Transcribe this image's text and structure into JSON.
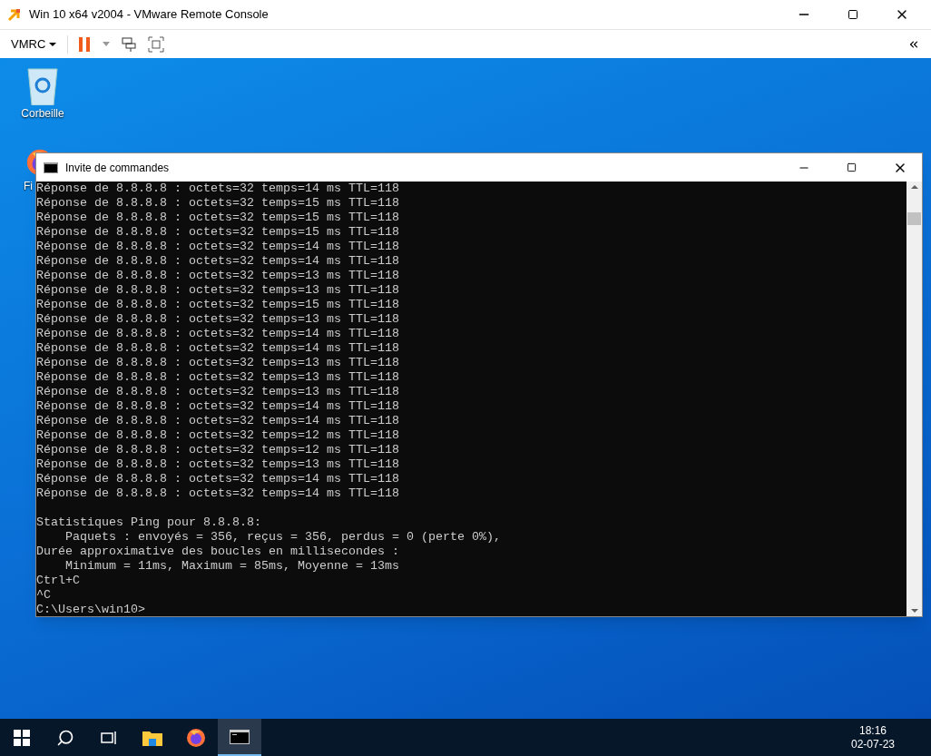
{
  "vmrc": {
    "title": "Win 10 x64 v2004 - VMware Remote Console",
    "menu": "VMRC"
  },
  "desktop_icons": [
    {
      "label": "Corbeille",
      "kind": "recycle"
    },
    {
      "label": "Fi",
      "kind": "firefox"
    }
  ],
  "cmd": {
    "title": "Invite de commandes",
    "blocks": [
      [
        "Réponse de 8.8.8.8 : octets=32 temps=14 ms TTL=118",
        "Réponse de 8.8.8.8 : octets=32 temps=15 ms TTL=118",
        "Réponse de 8.8.8.8 : octets=32 temps=15 ms TTL=118",
        "Réponse de 8.8.8.8 : octets=32 temps=15 ms TTL=118",
        "Réponse de 8.8.8.8 : octets=32 temps=14 ms TTL=118",
        "Réponse de 8.8.8.8 : octets=32 temps=14 ms TTL=118",
        "Réponse de 8.8.8.8 : octets=32 temps=13 ms TTL=118",
        "Réponse de 8.8.8.8 : octets=32 temps=13 ms TTL=118",
        "Réponse de 8.8.8.8 : octets=32 temps=15 ms TTL=118",
        "Réponse de 8.8.8.8 : octets=32 temps=13 ms TTL=118",
        "Réponse de 8.8.8.8 : octets=32 temps=14 ms TTL=118",
        "Réponse de 8.8.8.8 : octets=32 temps=14 ms TTL=118",
        "Réponse de 8.8.8.8 : octets=32 temps=13 ms TTL=118",
        "Réponse de 8.8.8.8 : octets=32 temps=13 ms TTL=118",
        "Réponse de 8.8.8.8 : octets=32 temps=13 ms TTL=118",
        "Réponse de 8.8.8.8 : octets=32 temps=14 ms TTL=118",
        "Réponse de 8.8.8.8 : octets=32 temps=14 ms TTL=118",
        "Réponse de 8.8.8.8 : octets=32 temps=12 ms TTL=118",
        "Réponse de 8.8.8.8 : octets=32 temps=12 ms TTL=118",
        "Réponse de 8.8.8.8 : octets=32 temps=13 ms TTL=118",
        "Réponse de 8.8.8.8 : octets=32 temps=14 ms TTL=118",
        "Réponse de 8.8.8.8 : octets=32 temps=14 ms TTL=118"
      ],
      [
        "Statistiques Ping pour 8.8.8.8:",
        "    Paquets : envoyés = 356, reçus = 356, perdus = 0 (perte 0%),",
        "Durée approximative des boucles en millisecondes :",
        "    Minimum = 11ms, Maximum = 85ms, Moyenne = 13ms",
        "Ctrl+C",
        "^C",
        "C:\\Users\\win10>"
      ]
    ]
  },
  "taskbar": {
    "items": [
      {
        "kind": "start",
        "selected": false
      },
      {
        "kind": "search",
        "selected": false
      },
      {
        "kind": "taskview",
        "selected": false
      },
      {
        "kind": "explorer",
        "selected": false
      },
      {
        "kind": "firefox",
        "selected": false
      },
      {
        "kind": "cmd",
        "selected": true
      }
    ],
    "time": "18:16",
    "date": "02-07-23"
  }
}
